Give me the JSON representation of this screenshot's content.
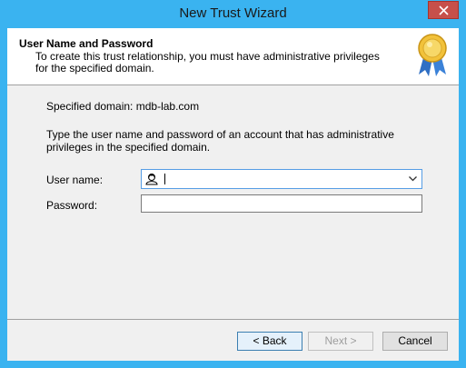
{
  "window": {
    "title": "New Trust Wizard",
    "close_glyph": "✕"
  },
  "header": {
    "title": "User Name and Password",
    "description": "To create this trust relationship, you must have administrative privileges for the specified domain.",
    "icon": "award-medal-icon"
  },
  "content": {
    "specified_domain": "Specified domain: mdb-lab.com",
    "instructions": "Type the user name and password of an account that has administrative privileges in the specified domain."
  },
  "form": {
    "user_label": "User name:",
    "user_value": "",
    "password_label": "Password:",
    "password_value": ""
  },
  "buttons": {
    "back": "< Back",
    "next": "Next >",
    "cancel": "Cancel"
  },
  "colors": {
    "titlebar": "#3ab3f0",
    "close": "#c7504a",
    "dialog_bg": "#f0f0f0"
  }
}
